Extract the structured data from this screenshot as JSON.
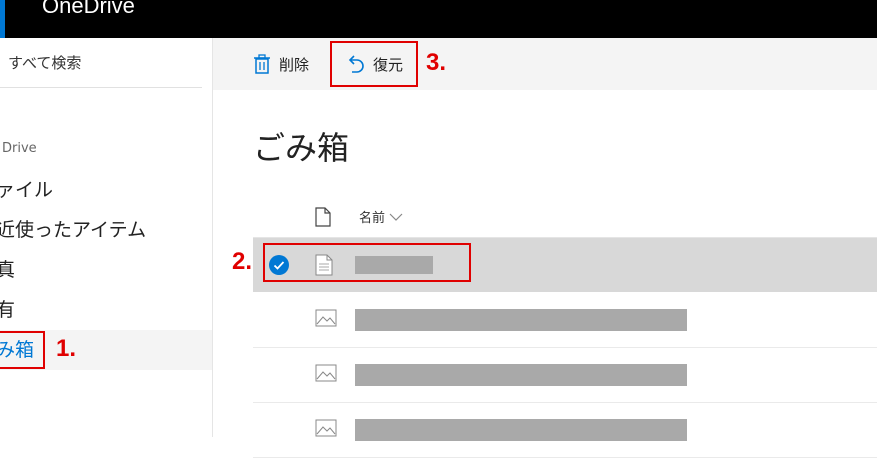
{
  "app": {
    "title": "OneDrive",
    "accent_color": "#0078d4"
  },
  "sidebar": {
    "search_label": "すべて検索",
    "section_label": "Drive",
    "items": [
      {
        "label": "ァイル"
      },
      {
        "label": "近使ったアイテム"
      },
      {
        "label": "真"
      },
      {
        "label": "有"
      },
      {
        "label": "み箱",
        "active": true
      }
    ]
  },
  "commandbar": {
    "delete_label": "削除",
    "restore_label": "復元"
  },
  "main": {
    "title": "ごみ箱",
    "column_name_label": "名前",
    "rows": [
      {
        "type": "document",
        "selected": true
      },
      {
        "type": "image",
        "selected": false
      },
      {
        "type": "image",
        "selected": false
      },
      {
        "type": "image",
        "selected": false
      }
    ]
  },
  "annotations": {
    "step1": "1.",
    "step2": "2.",
    "step3": "3.",
    "color": "#e00000"
  }
}
